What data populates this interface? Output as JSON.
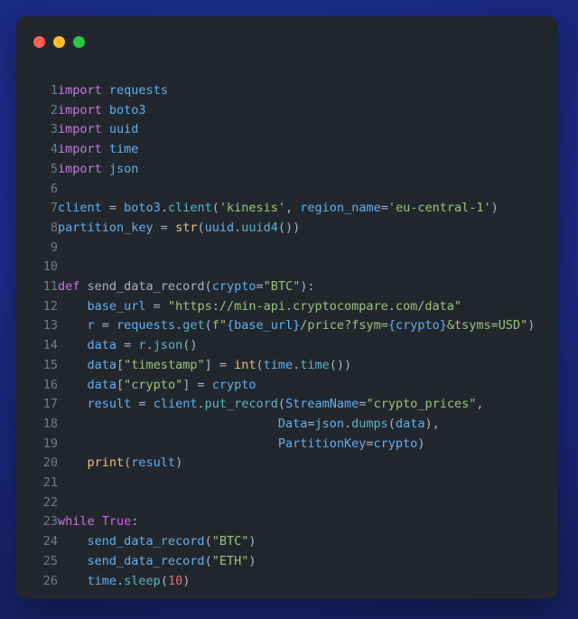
{
  "window": {
    "traffic_lights": [
      {
        "name": "close",
        "color": "#ff5f56"
      },
      {
        "name": "minimize",
        "color": "#ffbd2e"
      },
      {
        "name": "maximize",
        "color": "#27c93f"
      }
    ],
    "background_color": "#1b2a84",
    "panel_color": "#22272e"
  },
  "editor": {
    "language": "python",
    "gutter_color": "#707b86",
    "first_line": 1,
    "last_line": 26,
    "theme": {
      "keyword": "#c678dd",
      "constant": "#d55fde",
      "builtin": "#e5c07b",
      "string": "#98c379",
      "identifier": "#61afef",
      "method": "#56b6c2",
      "number": "#e06c75",
      "punctuation": "#abb2bf"
    },
    "lines": [
      {
        "n": "1",
        "tokens": [
          {
            "t": "import",
            "c": "kw"
          },
          {
            "t": " ",
            "c": "pun"
          },
          {
            "t": "requests",
            "c": "var"
          }
        ]
      },
      {
        "n": "2",
        "tokens": [
          {
            "t": "import",
            "c": "kw"
          },
          {
            "t": " ",
            "c": "pun"
          },
          {
            "t": "boto3",
            "c": "var"
          }
        ]
      },
      {
        "n": "3",
        "tokens": [
          {
            "t": "import",
            "c": "kw"
          },
          {
            "t": " ",
            "c": "pun"
          },
          {
            "t": "uuid",
            "c": "var"
          }
        ]
      },
      {
        "n": "4",
        "tokens": [
          {
            "t": "import",
            "c": "kw"
          },
          {
            "t": " ",
            "c": "pun"
          },
          {
            "t": "time",
            "c": "var"
          }
        ]
      },
      {
        "n": "5",
        "tokens": [
          {
            "t": "import",
            "c": "kw"
          },
          {
            "t": " ",
            "c": "pun"
          },
          {
            "t": "json",
            "c": "var"
          }
        ]
      },
      {
        "n": "6",
        "tokens": []
      },
      {
        "n": "7",
        "tokens": [
          {
            "t": "client",
            "c": "var"
          },
          {
            "t": " = ",
            "c": "pun"
          },
          {
            "t": "boto3",
            "c": "var"
          },
          {
            "t": ".",
            "c": "pun"
          },
          {
            "t": "client",
            "c": "mth"
          },
          {
            "t": "(",
            "c": "pun"
          },
          {
            "t": "'kinesis'",
            "c": "str"
          },
          {
            "t": ", ",
            "c": "pun"
          },
          {
            "t": "region_name",
            "c": "var"
          },
          {
            "t": "=",
            "c": "pun"
          },
          {
            "t": "'eu-central-1'",
            "c": "str"
          },
          {
            "t": ")",
            "c": "pun"
          }
        ]
      },
      {
        "n": "8",
        "tokens": [
          {
            "t": "partition_key",
            "c": "var"
          },
          {
            "t": " = ",
            "c": "pun"
          },
          {
            "t": "str",
            "c": "bif"
          },
          {
            "t": "(",
            "c": "pun"
          },
          {
            "t": "uuid",
            "c": "var"
          },
          {
            "t": ".",
            "c": "pun"
          },
          {
            "t": "uuid4",
            "c": "mth"
          },
          {
            "t": "())",
            "c": "pun"
          }
        ]
      },
      {
        "n": "9",
        "tokens": []
      },
      {
        "n": "10",
        "tokens": []
      },
      {
        "n": "11",
        "tokens": [
          {
            "t": "def",
            "c": "kw"
          },
          {
            "t": " send_data_record(",
            "c": "pun"
          },
          {
            "t": "crypto",
            "c": "var"
          },
          {
            "t": "=",
            "c": "pun"
          },
          {
            "t": "\"BTC\"",
            "c": "str"
          },
          {
            "t": "):",
            "c": "pun"
          }
        ]
      },
      {
        "n": "12",
        "tokens": [
          {
            "t": "    ",
            "c": "pun"
          },
          {
            "t": "base_url",
            "c": "var"
          },
          {
            "t": " = ",
            "c": "pun"
          },
          {
            "t": "\"https://min-api.cryptocompare.com/data\"",
            "c": "str"
          }
        ]
      },
      {
        "n": "13",
        "tokens": [
          {
            "t": "    ",
            "c": "pun"
          },
          {
            "t": "r",
            "c": "var"
          },
          {
            "t": " = ",
            "c": "pun"
          },
          {
            "t": "requests",
            "c": "var"
          },
          {
            "t": ".",
            "c": "pun"
          },
          {
            "t": "get",
            "c": "mth"
          },
          {
            "t": "(",
            "c": "pun"
          },
          {
            "t": "f\"",
            "c": "str"
          },
          {
            "t": "{base_url}",
            "c": "var"
          },
          {
            "t": "/price?fsym=",
            "c": "str"
          },
          {
            "t": "{crypto}",
            "c": "var"
          },
          {
            "t": "&tsyms=USD\"",
            "c": "str"
          },
          {
            "t": ")",
            "c": "pun"
          }
        ]
      },
      {
        "n": "14",
        "tokens": [
          {
            "t": "    ",
            "c": "pun"
          },
          {
            "t": "data",
            "c": "var"
          },
          {
            "t": " = ",
            "c": "pun"
          },
          {
            "t": "r",
            "c": "var"
          },
          {
            "t": ".",
            "c": "pun"
          },
          {
            "t": "json",
            "c": "mth"
          },
          {
            "t": "()",
            "c": "pun"
          }
        ]
      },
      {
        "n": "15",
        "tokens": [
          {
            "t": "    ",
            "c": "pun"
          },
          {
            "t": "data",
            "c": "var"
          },
          {
            "t": "[",
            "c": "pun"
          },
          {
            "t": "\"timestamp\"",
            "c": "str"
          },
          {
            "t": "] = ",
            "c": "pun"
          },
          {
            "t": "int",
            "c": "bif"
          },
          {
            "t": "(",
            "c": "pun"
          },
          {
            "t": "time",
            "c": "var"
          },
          {
            "t": ".",
            "c": "pun"
          },
          {
            "t": "time",
            "c": "mth"
          },
          {
            "t": "())",
            "c": "pun"
          }
        ]
      },
      {
        "n": "16",
        "tokens": [
          {
            "t": "    ",
            "c": "pun"
          },
          {
            "t": "data",
            "c": "var"
          },
          {
            "t": "[",
            "c": "pun"
          },
          {
            "t": "\"crypto\"",
            "c": "str"
          },
          {
            "t": "] = ",
            "c": "pun"
          },
          {
            "t": "crypto",
            "c": "var"
          }
        ]
      },
      {
        "n": "17",
        "tokens": [
          {
            "t": "    ",
            "c": "pun"
          },
          {
            "t": "result",
            "c": "var"
          },
          {
            "t": " = ",
            "c": "pun"
          },
          {
            "t": "client",
            "c": "var"
          },
          {
            "t": ".",
            "c": "pun"
          },
          {
            "t": "put_record",
            "c": "mth"
          },
          {
            "t": "(",
            "c": "pun"
          },
          {
            "t": "StreamName",
            "c": "var"
          },
          {
            "t": "=",
            "c": "pun"
          },
          {
            "t": "\"crypto_prices\"",
            "c": "str"
          },
          {
            "t": ",",
            "c": "pun"
          }
        ]
      },
      {
        "n": "18",
        "tokens": [
          {
            "t": "                              ",
            "c": "pun"
          },
          {
            "t": "Data",
            "c": "var"
          },
          {
            "t": "=",
            "c": "pun"
          },
          {
            "t": "json",
            "c": "var"
          },
          {
            "t": ".",
            "c": "pun"
          },
          {
            "t": "dumps",
            "c": "mth"
          },
          {
            "t": "(",
            "c": "pun"
          },
          {
            "t": "data",
            "c": "var"
          },
          {
            "t": "),",
            "c": "pun"
          }
        ]
      },
      {
        "n": "19",
        "tokens": [
          {
            "t": "                              ",
            "c": "pun"
          },
          {
            "t": "PartitionKey",
            "c": "var"
          },
          {
            "t": "=",
            "c": "pun"
          },
          {
            "t": "crypto",
            "c": "var"
          },
          {
            "t": ")",
            "c": "pun"
          }
        ]
      },
      {
        "n": "20",
        "tokens": [
          {
            "t": "    ",
            "c": "pun"
          },
          {
            "t": "print",
            "c": "bif"
          },
          {
            "t": "(",
            "c": "pun"
          },
          {
            "t": "result",
            "c": "var"
          },
          {
            "t": ")",
            "c": "pun"
          }
        ]
      },
      {
        "n": "21",
        "tokens": []
      },
      {
        "n": "22",
        "tokens": []
      },
      {
        "n": "23",
        "tokens": [
          {
            "t": "while",
            "c": "kw"
          },
          {
            "t": " ",
            "c": "pun"
          },
          {
            "t": "True",
            "c": "cst"
          },
          {
            "t": ":",
            "c": "pun"
          }
        ]
      },
      {
        "n": "24",
        "tokens": [
          {
            "t": "    ",
            "c": "pun"
          },
          {
            "t": "send_data_record",
            "c": "var"
          },
          {
            "t": "(",
            "c": "pun"
          },
          {
            "t": "\"BTC\"",
            "c": "str"
          },
          {
            "t": ")",
            "c": "pun"
          }
        ]
      },
      {
        "n": "25",
        "tokens": [
          {
            "t": "    ",
            "c": "pun"
          },
          {
            "t": "send_data_record",
            "c": "var"
          },
          {
            "t": "(",
            "c": "pun"
          },
          {
            "t": "\"ETH\"",
            "c": "str"
          },
          {
            "t": ")",
            "c": "pun"
          }
        ]
      },
      {
        "n": "26",
        "tokens": [
          {
            "t": "    ",
            "c": "pun"
          },
          {
            "t": "time",
            "c": "var"
          },
          {
            "t": ".",
            "c": "pun"
          },
          {
            "t": "sleep",
            "c": "mth"
          },
          {
            "t": "(",
            "c": "pun"
          },
          {
            "t": "10",
            "c": "num"
          },
          {
            "t": ")",
            "c": "pun"
          }
        ]
      }
    ]
  }
}
